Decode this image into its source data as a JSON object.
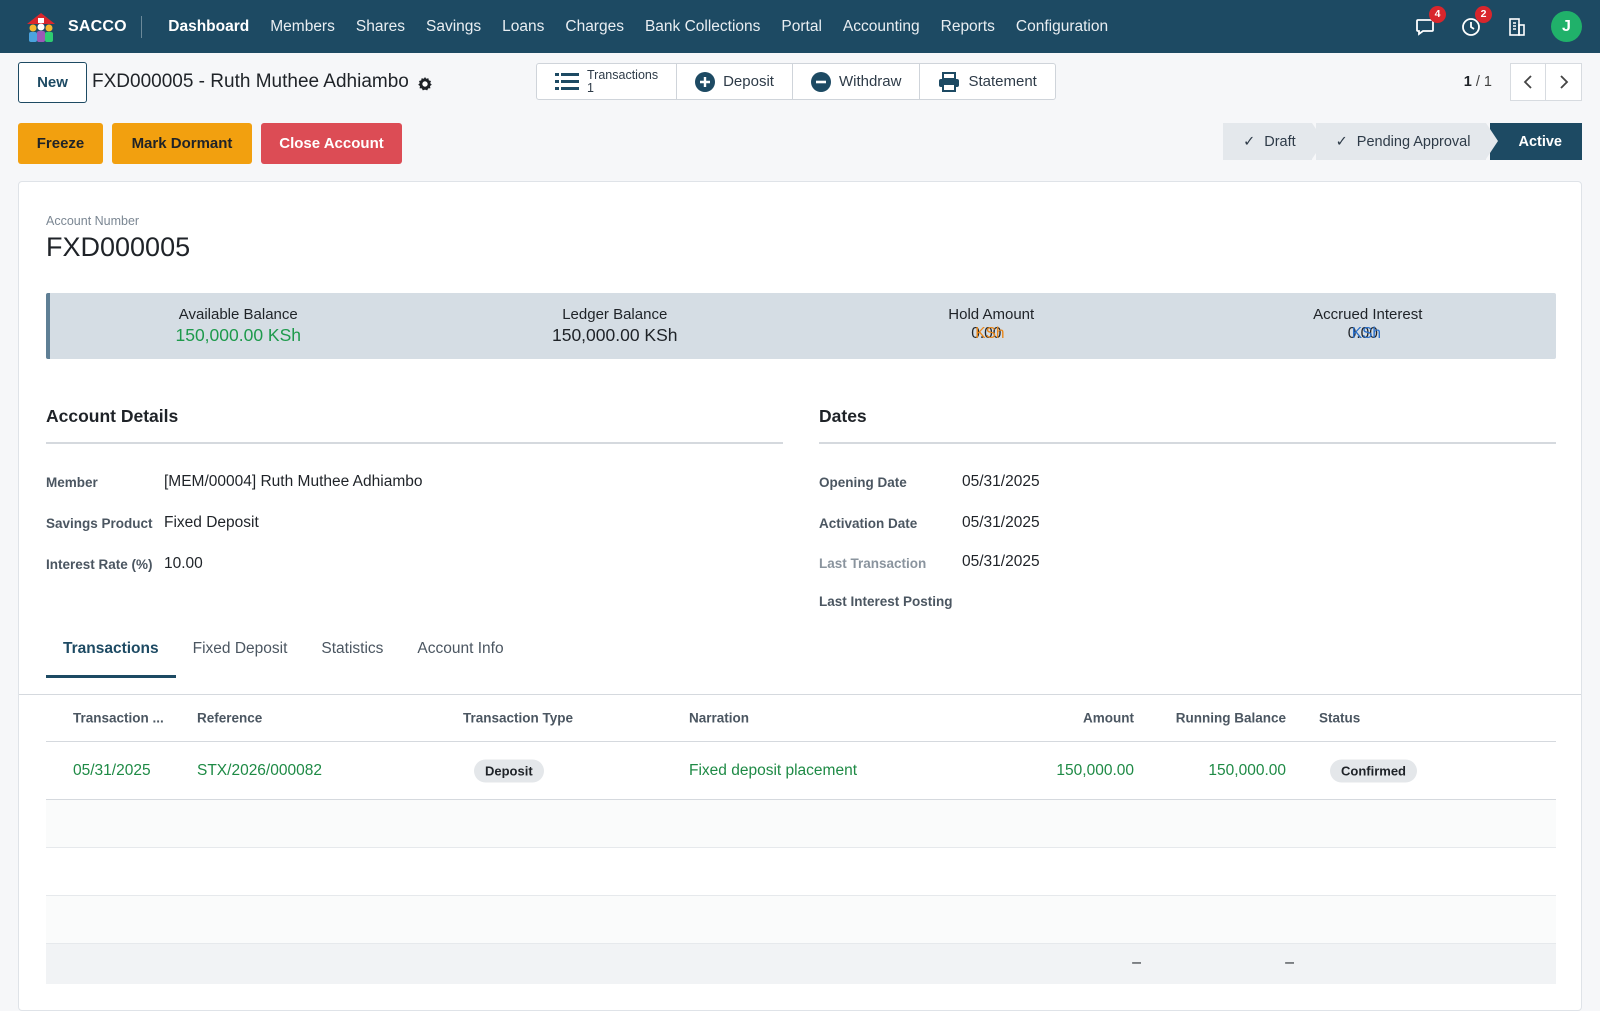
{
  "navbar": {
    "brand": "SACCO",
    "menu": [
      "Dashboard",
      "Members",
      "Shares",
      "Savings",
      "Loans",
      "Charges",
      "Bank Collections",
      "Portal",
      "Accounting",
      "Reports",
      "Configuration"
    ],
    "messages_badge": "4",
    "activities_badge": "2",
    "avatar_initial": "J"
  },
  "control": {
    "new_label": "New",
    "record_title": "FXD000005 - Ruth Muthee Adhiambo",
    "smart_buttons": {
      "transactions_label": "Transactions",
      "transactions_count": "1",
      "deposit_label": "Deposit",
      "withdraw_label": "Withdraw",
      "statement_label": "Statement"
    },
    "pager_current": "1",
    "pager_total": "/ 1",
    "actions": {
      "freeze": "Freeze",
      "mark_dormant": "Mark Dormant",
      "close_account": "Close Account"
    },
    "stages": [
      "Draft",
      "Pending Approval",
      "Active"
    ]
  },
  "account": {
    "number_label": "Account Number",
    "number": "FXD000005",
    "balances": {
      "available_label": "Available Balance",
      "available": "150,000.00 KSh",
      "ledger_label": "Ledger Balance",
      "ledger": "150,000.00 KSh",
      "hold_label": "Hold Amount",
      "hold_value": "0.00",
      "hold_currency": "KSh",
      "accrued_label": "Accrued Interest",
      "accrued_value": "0.00",
      "accrued_currency": "KSh"
    }
  },
  "details": {
    "title": "Account Details",
    "member_label": "Member",
    "member": "[MEM/00004] Ruth Muthee Adhiambo",
    "product_label": "Savings Product",
    "product": "Fixed Deposit",
    "rate_label": "Interest Rate (%)",
    "rate": "10.00"
  },
  "dates": {
    "title": "Dates",
    "opening_label": "Opening Date",
    "opening": "05/31/2025",
    "activation_label": "Activation Date",
    "activation": "05/31/2025",
    "last_tx_label": "Last Transaction",
    "last_tx": "05/31/2025",
    "last_interest_label": "Last Interest Posting"
  },
  "tabs": [
    "Transactions",
    "Fixed Deposit",
    "Statistics",
    "Account Info"
  ],
  "transactions": {
    "headers": [
      "Transaction ...",
      "Reference",
      "Transaction Type",
      "Narration",
      "Amount",
      "Running Balance",
      "Status"
    ],
    "rows": [
      {
        "date": "05/31/2025",
        "reference": "STX/2026/000082",
        "type": "Deposit",
        "narration": "Fixed deposit placement",
        "amount": "150,000.00",
        "running_balance": "150,000.00",
        "status": "Confirmed"
      }
    ],
    "footer_amount": "–",
    "footer_running": "–"
  },
  "colors": {
    "navbar": "#1d4a63",
    "warning": "#f2a00f",
    "danger": "#dc4c55",
    "success_text": "#1e9a4c",
    "hold_overlay": "#e8861a",
    "accrued_overlay": "#2a6fc9"
  }
}
